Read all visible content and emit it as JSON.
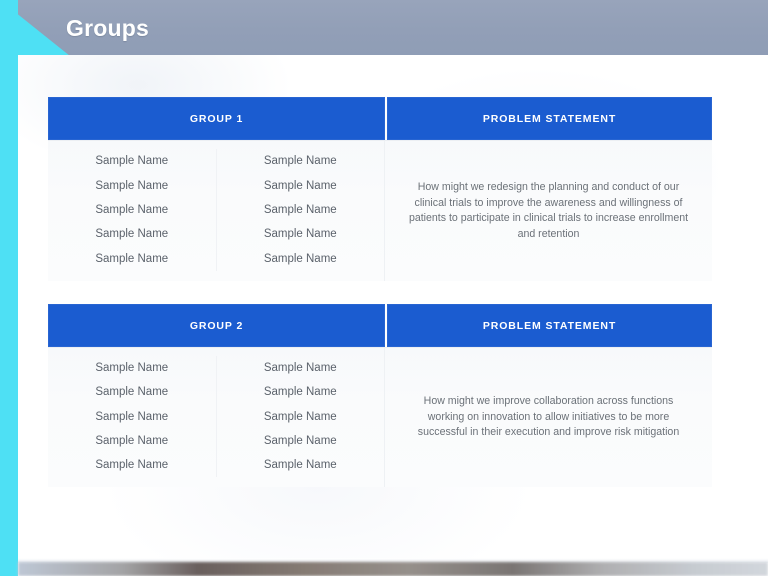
{
  "slide": {
    "title": "Groups",
    "accent_color": "#4ee0f4",
    "header_band_color": "#929fb7",
    "table_header_color": "#1b5cd0",
    "body_background_color": "#f8fafb"
  },
  "tables": [
    {
      "id": "table-1",
      "group_header": "GROUP 1",
      "problem_header": "PROBLEM STATEMENT",
      "names_left": [
        "Sample Name",
        "Sample Name",
        "Sample Name",
        "Sample Name",
        "Sample Name"
      ],
      "names_right": [
        "Sample Name",
        "Sample Name",
        "Sample Name",
        "Sample Name",
        "Sample Name"
      ],
      "problem_statement": "How might we redesign the planning and conduct of our clinical trials to improve the awareness and willingness of patients to participate in clinical trials to increase enrollment and retention"
    },
    {
      "id": "table-2",
      "group_header": "GROUP 2",
      "problem_header": "PROBLEM STATEMENT",
      "names_left": [
        "Sample Name",
        "Sample Name",
        "Sample Name",
        "Sample Name",
        "Sample Name"
      ],
      "names_right": [
        "Sample Name",
        "Sample Name",
        "Sample Name",
        "Sample Name",
        "Sample Name"
      ],
      "problem_statement": "How might we improve collaboration across functions working on innovation to allow initiatives to be more successful in their execution and improve risk mitigation"
    }
  ]
}
